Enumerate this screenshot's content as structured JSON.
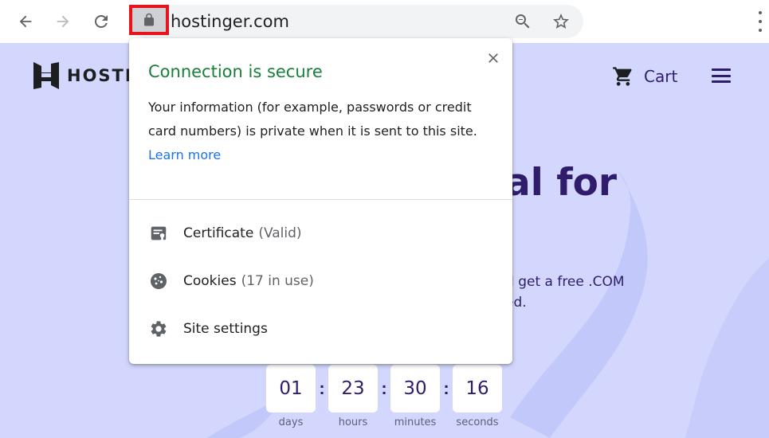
{
  "browser": {
    "url": "hostinger.com",
    "icons": {
      "back": "back-arrow-icon",
      "forward": "forward-arrow-icon",
      "reload": "reload-icon",
      "lock": "lock-icon",
      "zoom": "zoom-out-icon",
      "bookmark": "star-icon",
      "menu": "more-vert-icon"
    }
  },
  "site": {
    "logo_text": "HOSTINGER",
    "cart_label": "Cart",
    "hero_title": "al for",
    "hero_sub_1": "d get a free .COM",
    "hero_sub_2": "ed.",
    "countdown": [
      {
        "value": "01",
        "label": "days"
      },
      {
        "value": "23",
        "label": "hours"
      },
      {
        "value": "30",
        "label": "minutes"
      },
      {
        "value": "16",
        "label": "seconds"
      }
    ],
    "separator": ":"
  },
  "popup": {
    "title": "Connection is secure",
    "body": "Your information (for example, passwords or credit card numbers) is private when it is sent to this site.",
    "link": "Learn more",
    "rows": [
      {
        "label": "Certificate",
        "status": "(Valid)",
        "icon": "certificate-icon"
      },
      {
        "label": "Cookies",
        "status": "(17 in use)",
        "icon": "cookie-icon"
      },
      {
        "label": "Site settings",
        "status": "",
        "icon": "gear-icon"
      }
    ]
  },
  "colors": {
    "secure_green": "#188038",
    "link_blue": "#1a73e8",
    "page_bg": "#d3d7fd",
    "brand_purple": "#2f1c6a",
    "highlight_red": "#e8141b"
  }
}
